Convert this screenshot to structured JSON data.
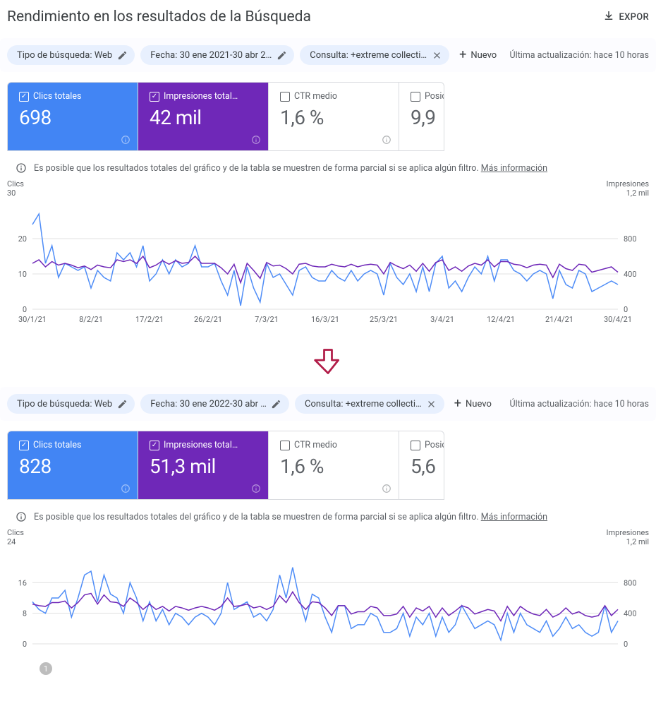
{
  "header": {
    "title": "Rendimiento en los resultados de la Búsqueda",
    "export_label": "EXPOR"
  },
  "shared": {
    "new_filter_label": "Nuevo",
    "last_update_label": "Última actualización: hace 10 horas",
    "notice_text": "Es posible que los resultados totales del gráfico y de la tabla se muestren de forma parcial si se aplica algún filtro.",
    "notice_link": "Más información",
    "left_axis_title": "Clics",
    "right_axis_title": "Impresiones",
    "right_axis_max_label": "1,2 mil",
    "metric_labels": {
      "clicks": "Clics totales",
      "impressions": "Impresiones total…",
      "ctr": "CTR medio",
      "position": "Posición media"
    }
  },
  "sections": [
    {
      "chips": [
        {
          "label": "Tipo de búsqueda: Web",
          "closable": false
        },
        {
          "label": "Fecha: 30 ene 2021-30 abr 2…",
          "closable": false
        },
        {
          "label": "Consulta: +extreme collecti…",
          "closable": true
        }
      ],
      "metrics": {
        "clicks": "698",
        "impressions": "42 mil",
        "ctr": "1,6 %",
        "position": "9,9"
      },
      "left_axis_max": "30",
      "x_ticks": [
        "30/1/21",
        "8/2/21",
        "17/2/21",
        "26/2/21",
        "7/3/21",
        "16/3/21",
        "25/3/21",
        "3/4/21",
        "12/4/21",
        "21/4/21",
        "30/4/21"
      ]
    },
    {
      "chips": [
        {
          "label": "Tipo de búsqueda: Web",
          "closable": false
        },
        {
          "label": "Fecha: 30 ene 2022-30 abr …",
          "closable": false
        },
        {
          "label": "Consulta: +extreme collecti…",
          "closable": true
        }
      ],
      "metrics": {
        "clicks": "828",
        "impressions": "51,3 mil",
        "ctr": "1,6 %",
        "position": "5,6"
      },
      "left_axis_max": "24",
      "x_ticks": [
        ""
      ]
    }
  ],
  "chart_data": [
    {
      "type": "line",
      "title": "",
      "xlabel": "",
      "ylabel_left": "Clics",
      "ylabel_right": "Impresiones",
      "left_axis": {
        "min": 0,
        "max": 30,
        "ticks": [
          0,
          10,
          20,
          30
        ]
      },
      "right_axis": {
        "min": 0,
        "max": 1200,
        "ticks": [
          0,
          400,
          800,
          1200
        ]
      },
      "x_ticks": [
        "30/1/21",
        "8/2/21",
        "17/2/21",
        "26/2/21",
        "7/3/21",
        "16/3/21",
        "25/3/21",
        "3/4/21",
        "12/4/21",
        "21/4/21",
        "30/4/21"
      ],
      "series": [
        {
          "name": "Clics",
          "axis": "left",
          "values": [
            24,
            27,
            13,
            18,
            9,
            13,
            12,
            11,
            12,
            6,
            11,
            9,
            8,
            16,
            14,
            16,
            12,
            18,
            8,
            10,
            14,
            10,
            14,
            12,
            13,
            18,
            12,
            12,
            13,
            8,
            4,
            11,
            1,
            12,
            6,
            2,
            13,
            9,
            10,
            7,
            4,
            11,
            12,
            9,
            8,
            8,
            11,
            9,
            8,
            11,
            8,
            10,
            11,
            10,
            4,
            13,
            9,
            7,
            10,
            5,
            12,
            5,
            13,
            15,
            6,
            8,
            5,
            9,
            12,
            10,
            15,
            8,
            14,
            14,
            11,
            10,
            8,
            10,
            11,
            10,
            3,
            11,
            7,
            6,
            11,
            10,
            5,
            6,
            7,
            8,
            7
          ]
        },
        {
          "name": "Impresiones",
          "axis": "right",
          "values": [
            520,
            560,
            480,
            540,
            500,
            520,
            500,
            470,
            490,
            450,
            500,
            480,
            470,
            560,
            540,
            560,
            520,
            600,
            470,
            500,
            550,
            510,
            550,
            520,
            530,
            600,
            520,
            520,
            520,
            470,
            400,
            510,
            300,
            520,
            440,
            350,
            530,
            490,
            500,
            460,
            400,
            510,
            520,
            490,
            480,
            480,
            510,
            490,
            480,
            510,
            480,
            500,
            510,
            500,
            400,
            530,
            490,
            460,
            500,
            430,
            520,
            430,
            530,
            560,
            440,
            480,
            430,
            490,
            520,
            500,
            560,
            480,
            540,
            540,
            510,
            500,
            470,
            500,
            510,
            500,
            360,
            510,
            460,
            440,
            510,
            500,
            420,
            440,
            460,
            480,
            420
          ]
        }
      ]
    },
    {
      "type": "line",
      "title": "",
      "xlabel": "",
      "ylabel_left": "Clics",
      "ylabel_right": "Impresiones",
      "left_axis": {
        "min": 0,
        "max": 24,
        "ticks": [
          0,
          8,
          16,
          24
        ]
      },
      "right_axis": {
        "min": 0,
        "max": 1200,
        "ticks": [
          0,
          400,
          800,
          1200
        ]
      },
      "x_ticks": [
        ""
      ],
      "series": [
        {
          "name": "Clics",
          "axis": "left",
          "values": [
            11,
            9,
            8,
            12,
            12,
            14,
            7,
            12,
            18,
            19,
            11,
            18,
            13,
            12,
            8,
            16,
            12,
            6,
            11,
            6,
            9,
            5,
            8,
            7,
            5,
            7,
            8,
            7,
            5,
            8,
            16,
            9,
            10,
            11,
            7,
            8,
            6,
            9,
            18,
            12,
            20,
            12,
            6,
            13,
            12,
            7,
            3,
            10,
            10,
            4,
            5,
            5,
            8,
            7,
            3,
            3,
            4,
            8,
            2,
            7,
            5,
            8,
            2,
            7,
            3,
            5,
            10,
            7,
            4,
            5,
            6,
            5,
            1,
            8,
            3,
            8,
            5,
            4,
            3,
            6,
            2,
            4,
            7,
            4,
            5,
            3,
            2,
            3,
            10,
            3,
            6
          ]
        },
        {
          "name": "Impresiones",
          "axis": "right",
          "values": [
            520,
            500,
            490,
            540,
            540,
            560,
            470,
            540,
            640,
            660,
            520,
            640,
            550,
            540,
            490,
            600,
            540,
            450,
            520,
            450,
            490,
            430,
            490,
            470,
            440,
            470,
            490,
            470,
            440,
            490,
            600,
            490,
            500,
            520,
            470,
            490,
            450,
            490,
            630,
            540,
            680,
            540,
            450,
            550,
            540,
            470,
            370,
            500,
            500,
            390,
            420,
            420,
            490,
            470,
            370,
            370,
            390,
            490,
            350,
            470,
            430,
            490,
            350,
            470,
            370,
            430,
            500,
            470,
            390,
            420,
            450,
            430,
            300,
            490,
            370,
            490,
            430,
            390,
            370,
            450,
            350,
            390,
            470,
            390,
            420,
            370,
            350,
            370,
            500,
            370,
            450
          ]
        }
      ]
    }
  ]
}
